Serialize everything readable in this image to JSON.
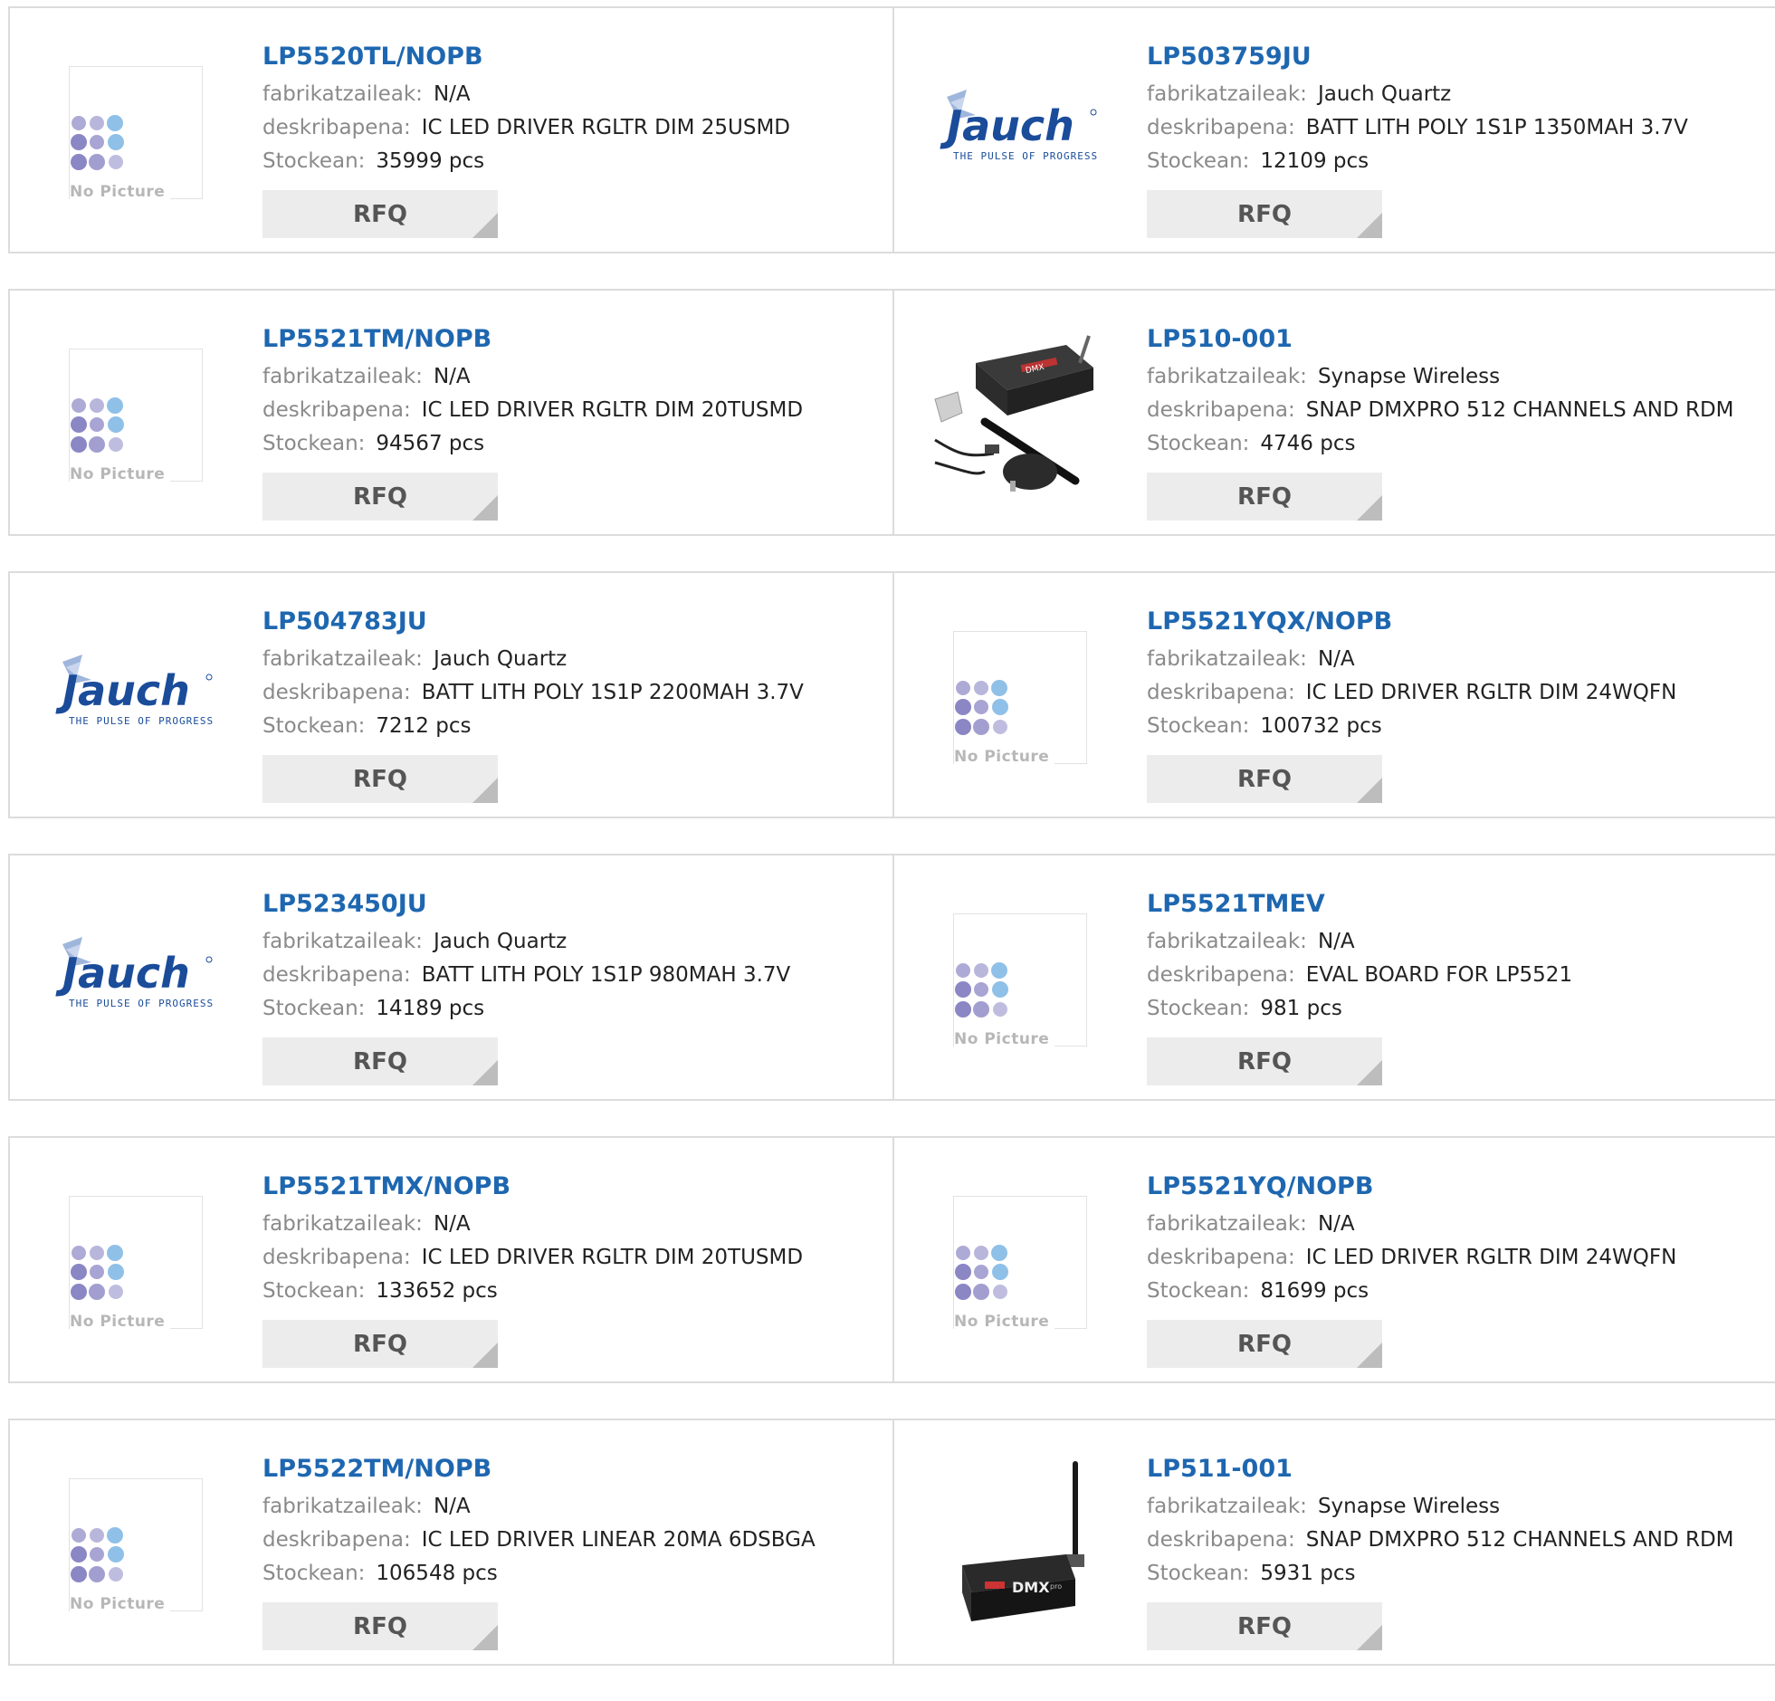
{
  "labels": {
    "manufacturer": "fabrikatzaileak:",
    "description": "deskribapena:",
    "stock": "Stockean:",
    "rfq": "RFQ",
    "no_picture": "No Picture",
    "jauch_logo": "Jauch",
    "jauch_tagline": "THE PULSE OF PROGRESS",
    "dmx_brand": "DMX",
    "dmx_suffix": "pro"
  },
  "products": [
    {
      "pn": "LP5520TL/NOPB",
      "manufacturer": "N/A",
      "description": "IC LED DRIVER RGLTR DIM 25USMD",
      "stock": "35999 pcs",
      "image": "no-picture"
    },
    {
      "pn": "LP503759JU",
      "manufacturer": "Jauch Quartz",
      "description": "BATT LITH POLY 1S1P 1350MAH 3.7V",
      "stock": "12109 pcs",
      "image": "jauch-logo"
    },
    {
      "pn": "LP5521TM/NOPB",
      "manufacturer": "N/A",
      "description": "IC LED DRIVER RGLTR DIM 20TUSMD",
      "stock": "94567 pcs",
      "image": "no-picture"
    },
    {
      "pn": "LP510-001",
      "manufacturer": "Synapse Wireless",
      "description": "SNAP DMXPRO 512 CHANNELS AND RDM",
      "stock": "4746 pcs",
      "image": "dmx-kit"
    },
    {
      "pn": "LP504783JU",
      "manufacturer": "Jauch Quartz",
      "description": "BATT LITH POLY 1S1P 2200MAH 3.7V",
      "stock": "7212 pcs",
      "image": "jauch-logo"
    },
    {
      "pn": "LP5521YQX/NOPB",
      "manufacturer": "N/A",
      "description": "IC LED DRIVER RGLTR DIM 24WQFN",
      "stock": "100732 pcs",
      "image": "no-picture"
    },
    {
      "pn": "LP523450JU",
      "manufacturer": "Jauch Quartz",
      "description": "BATT LITH POLY 1S1P 980MAH 3.7V",
      "stock": "14189 pcs",
      "image": "jauch-logo"
    },
    {
      "pn": "LP5521TMEV",
      "manufacturer": "N/A",
      "description": "EVAL BOARD FOR LP5521",
      "stock": "981 pcs",
      "image": "no-picture"
    },
    {
      "pn": "LP5521TMX/NOPB",
      "manufacturer": "N/A",
      "description": "IC LED DRIVER RGLTR DIM 20TUSMD",
      "stock": "133652 pcs",
      "image": "no-picture"
    },
    {
      "pn": "LP5521YQ/NOPB",
      "manufacturer": "N/A",
      "description": "IC LED DRIVER RGLTR DIM 24WQFN",
      "stock": "81699 pcs",
      "image": "no-picture"
    },
    {
      "pn": "LP5522TM/NOPB",
      "manufacturer": "N/A",
      "description": "IC LED DRIVER LINEAR 20MA 6DSBGA",
      "stock": "106548 pcs",
      "image": "no-picture"
    },
    {
      "pn": "LP511-001",
      "manufacturer": "Synapse Wireless",
      "description": "SNAP DMXPRO 512 CHANNELS AND RDM",
      "stock": "5931 pcs",
      "image": "dmx-device"
    }
  ],
  "colors": {
    "part_number": "#1e67b0",
    "label_gray": "#8a8a8a",
    "rfq_bg": "#ececec",
    "border": "#dcdcdc",
    "jauch_blue": "#1a4c9a",
    "dots_purple": "#8b86c4",
    "dots_blue": "#8fc0e8"
  }
}
